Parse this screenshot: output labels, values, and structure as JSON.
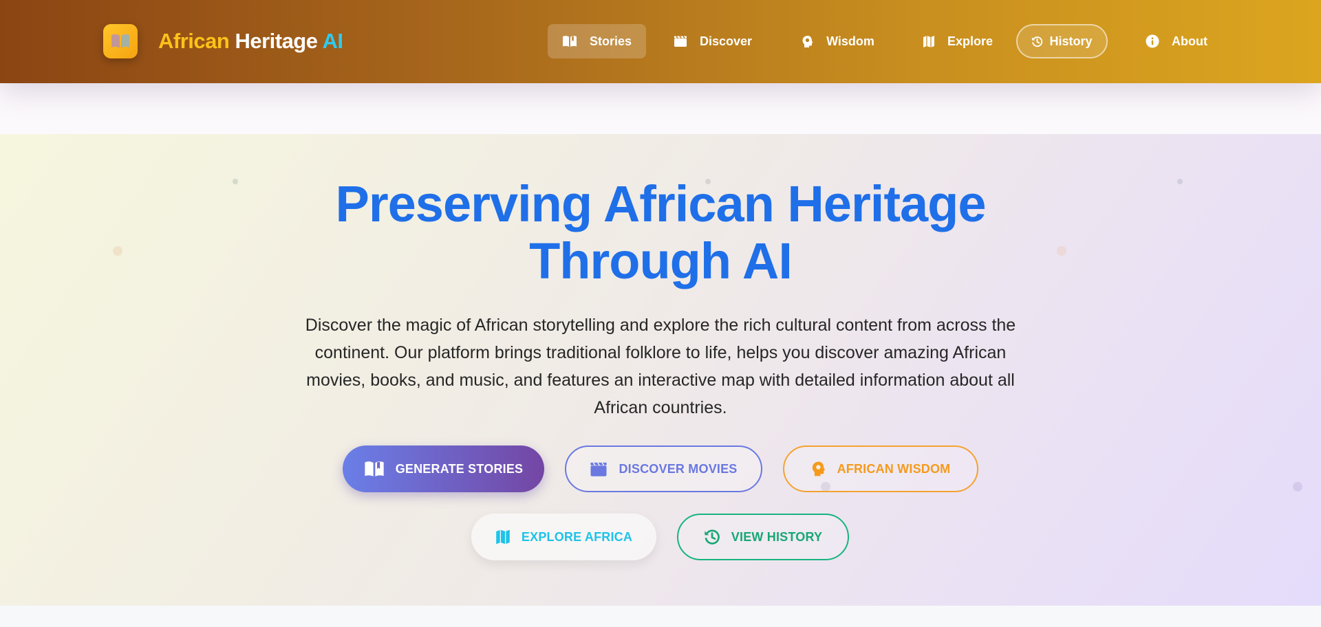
{
  "navbar": {
    "brand": {
      "part1": "African",
      "part2": "Heritage",
      "part3": "AI"
    },
    "items": [
      {
        "label": "Stories",
        "icon": "book-open-icon",
        "state": "active"
      },
      {
        "label": "Discover",
        "icon": "clapperboard-icon"
      },
      {
        "label": "Wisdom",
        "icon": "head-lightbulb-icon"
      },
      {
        "label": "Explore",
        "icon": "map-icon"
      },
      {
        "label": "History",
        "icon": "history-icon",
        "style": "outlined-pill"
      },
      {
        "label": "About",
        "icon": "info-circle-icon"
      }
    ]
  },
  "hero": {
    "title_line1": "Preserving African Heritage",
    "title_line2": "Through AI",
    "description": "Discover the magic of African storytelling and explore the rich cultural content from across the continent. Our platform brings traditional folklore to life, helps you discover amazing African movies, books, and music, and features an interactive map with detailed information about all African countries.",
    "buttons": [
      {
        "label": "GENERATE STORIES",
        "icon": "book-open-icon"
      },
      {
        "label": "DISCOVER MOVIES",
        "icon": "clapperboard-icon"
      },
      {
        "label": "AFRICAN WISDOM",
        "icon": "head-lightbulb-icon"
      },
      {
        "label": "EXPLORE AFRICA",
        "icon": "map-icon"
      },
      {
        "label": "VIEW HISTORY",
        "icon": "history-icon"
      }
    ]
  },
  "colors": {
    "navbar_gradient_start": "#8b4513",
    "navbar_gradient_end": "#dca51f",
    "brand_gold": "#ffc21a",
    "brand_cyan": "#2ecbf0",
    "hero_title": "#1f6fe8",
    "generate_gradient": [
      "#6a7fe8",
      "#7446a4"
    ],
    "movies": "#6a78e0",
    "wisdom": "#f59a1c",
    "explore": "#1dc3e8",
    "history": "#17a775"
  }
}
